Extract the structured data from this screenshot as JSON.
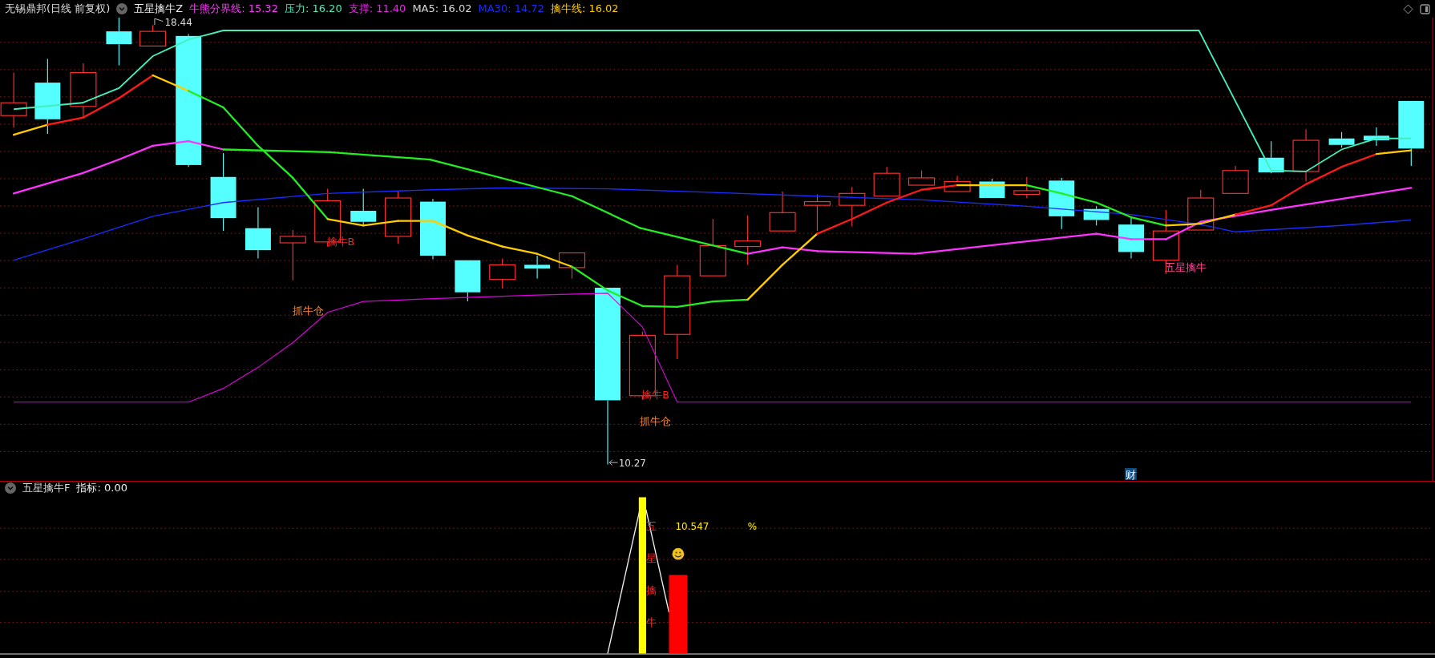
{
  "header": {
    "security": "无锡鼎邦(日线 前复权)",
    "indicator": "五星擒牛Z",
    "values": [
      {
        "label": "牛熊分界线:",
        "value": "15.32",
        "color": "#ff33ff"
      },
      {
        "label": "压力:",
        "value": "16.20",
        "color": "#44eebb"
      },
      {
        "label": "支撑:",
        "value": "11.40",
        "color": "#ee22ee"
      },
      {
        "label": "MA5:",
        "value": "16.02",
        "color": "#d8d8d8"
      },
      {
        "label": "MA30:",
        "value": "14.72",
        "color": "#1a2cff"
      },
      {
        "label": "擒牛线:",
        "value": "16.02",
        "color": "#ffcc00"
      }
    ]
  },
  "main_chart": {
    "high_mark": "18.44",
    "low_mark": "10.27",
    "signals": [
      {
        "kind": "buy",
        "text": "擒牛B"
      },
      {
        "kind": "zone",
        "text": "抓牛仓"
      },
      {
        "kind": "buy",
        "text": "擒牛B"
      },
      {
        "kind": "zone",
        "text": "抓牛仓"
      },
      {
        "kind": "star",
        "text": "五星擒牛"
      }
    ],
    "badge": "财"
  },
  "sub_panel": {
    "indicator": "五星擒牛F",
    "reading_label": "指标:",
    "reading_value": "0.00",
    "bar_text": "五星擒牛",
    "value": "10.547",
    "unit": "%"
  }
}
